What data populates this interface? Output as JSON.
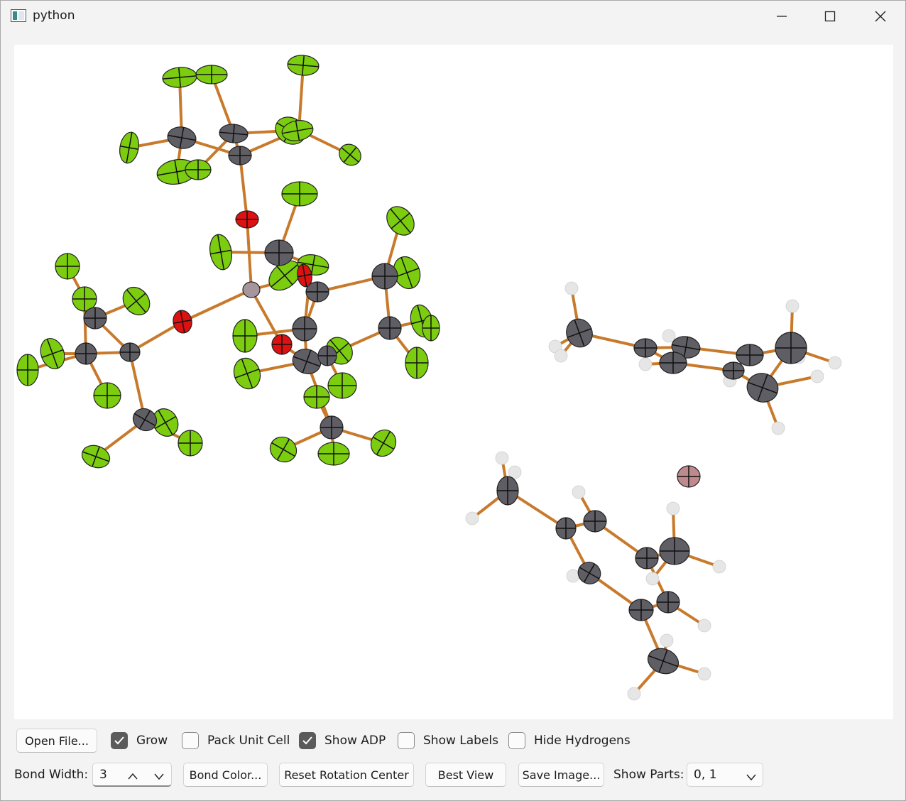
{
  "window": {
    "title": "python"
  },
  "toolbar": {
    "open_file": "Open File...",
    "grow": {
      "label": "Grow",
      "checked": true
    },
    "pack_unit_cell": {
      "label": "Pack Unit Cell",
      "checked": false
    },
    "show_adp": {
      "label": "Show ADP",
      "checked": true
    },
    "show_labels": {
      "label": "Show Labels",
      "checked": false
    },
    "hide_hydrogens": {
      "label": "Hide Hydrogens",
      "checked": false
    },
    "bond_width_label": "Bond Width:",
    "bond_width_value": "3",
    "bond_color": "Bond Color...",
    "reset_rotation_center": "Reset Rotation Center",
    "best_view": "Best View",
    "save_image": "Save Image...",
    "show_parts_label": "Show Parts:",
    "show_parts_value": "0, 1"
  },
  "colors": {
    "bond": "#c87a2c",
    "fluorine": "#7ccc10",
    "carbon": "#5e5e64",
    "oxygen": "#dd1111",
    "hydrogen": "#e6e6e6",
    "central_atom": "#a7959d",
    "ion": "#bf8a8e"
  }
}
